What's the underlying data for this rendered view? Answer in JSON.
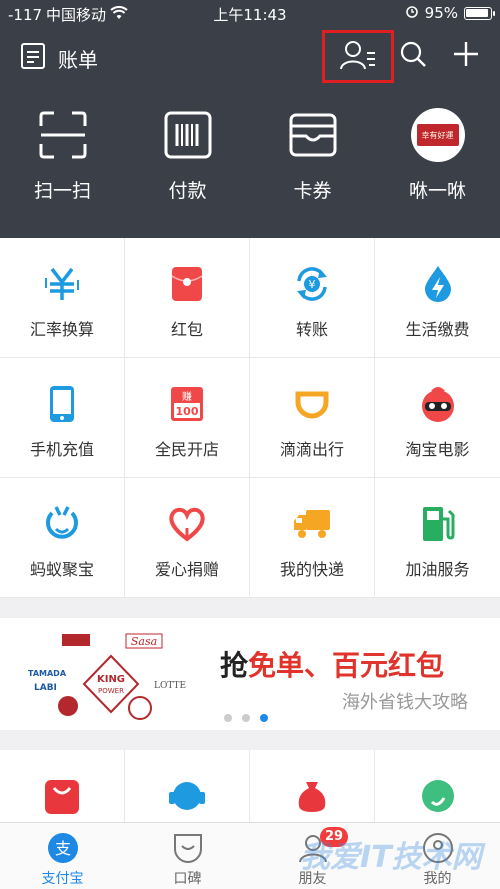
{
  "status_bar": {
    "signal": "-117",
    "carrier": "中国移动",
    "time": "上午11:43",
    "battery": "95%"
  },
  "header": {
    "bill_label": "账单"
  },
  "quick_actions": [
    {
      "label": "扫一扫",
      "icon": "scan-icon"
    },
    {
      "label": "付款",
      "icon": "barcode-icon"
    },
    {
      "label": "卡券",
      "icon": "wallet-icon"
    },
    {
      "label": "咻一咻",
      "icon": "meiyi-logo",
      "logo_text": "幸有好運"
    }
  ],
  "grid": [
    {
      "label": "汇率换算",
      "icon": "yen-exchange-icon",
      "color": "#1e9ae0"
    },
    {
      "label": "红包",
      "icon": "red-packet-icon",
      "color": "#f04848"
    },
    {
      "label": "转账",
      "icon": "transfer-icon",
      "color": "#1e9ae0"
    },
    {
      "label": "生活缴费",
      "icon": "utility-drop-icon",
      "color": "#1e9ae0"
    },
    {
      "label": "手机充值",
      "icon": "phone-icon",
      "color": "#1e9ae0"
    },
    {
      "label": "全民开店",
      "icon": "shop-100-icon",
      "color": "#f04848",
      "badge_top": "赚",
      "badge_bottom": "100"
    },
    {
      "label": "滴滴出行",
      "icon": "didi-icon",
      "color": "#f5a623"
    },
    {
      "label": "淘宝电影",
      "icon": "movie-mascot-icon",
      "color": "#f04848"
    },
    {
      "label": "蚂蚁聚宝",
      "icon": "ant-fortune-icon",
      "color": "#1e9ae0"
    },
    {
      "label": "爱心捐赠",
      "icon": "heart-icon",
      "color": "#f04848"
    },
    {
      "label": "我的快递",
      "icon": "truck-icon",
      "color": "#f5a623"
    },
    {
      "label": "加油服务",
      "icon": "fuel-pump-icon",
      "color": "#27ae60"
    }
  ],
  "banner": {
    "title_prefix": "抢",
    "title_highlight": "免单、百元红包",
    "subtitle": "海外省钱大攻略",
    "brands": [
      "TAMADA",
      "LABI",
      "KING POWER",
      "Sasa",
      "LOTTE"
    ]
  },
  "tabs": [
    {
      "label": "支付宝",
      "icon": "alipay-icon",
      "active": true
    },
    {
      "label": "口碑",
      "icon": "koubei-icon",
      "active": false
    },
    {
      "label": "朋友",
      "icon": "friends-icon",
      "active": false,
      "badge": "29"
    },
    {
      "label": "我的",
      "icon": "profile-icon",
      "active": false
    }
  ],
  "watermark": "我爱IT技术网",
  "colors": {
    "header_bg": "#3b3f47",
    "accent_blue": "#1e88e5",
    "accent_red": "#e0332b",
    "highlight_box": "#e02020"
  }
}
